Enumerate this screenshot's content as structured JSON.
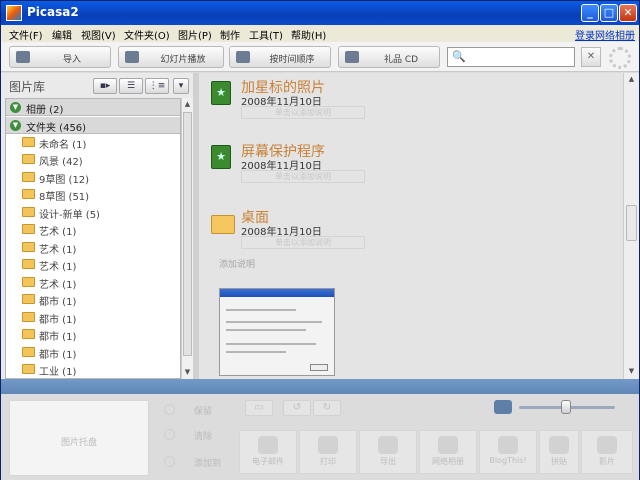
{
  "window": {
    "title": "Picasa2"
  },
  "menu": {
    "items": [
      "文件(F)",
      "编辑",
      "视图(V)",
      "文件夹(O)",
      "图片(P)",
      "制作",
      "工具(T)",
      "帮助(H)"
    ],
    "login": "登录网络相册"
  },
  "toolbar": {
    "import": "导入",
    "slideshow": "幻灯片播放",
    "timeline": "按时间顺序",
    "giftcd": "礼品 CD",
    "search_placeholder": ""
  },
  "library": {
    "title": "图片库",
    "groups": [
      {
        "label": "相册 (2)"
      },
      {
        "label": "文件夹 (456)"
      }
    ],
    "folders": [
      {
        "label": "未命名 (1)"
      },
      {
        "label": "风景 (42)"
      },
      {
        "label": "9草图 (12)"
      },
      {
        "label": "8草图 (51)"
      },
      {
        "label": "设计-新单 (5)"
      },
      {
        "label": "艺术 (1)"
      },
      {
        "label": "艺术 (1)"
      },
      {
        "label": "艺术 (1)"
      },
      {
        "label": "艺术 (1)"
      },
      {
        "label": "都市 (1)"
      },
      {
        "label": "都市 (1)"
      },
      {
        "label": "都市 (1)"
      },
      {
        "label": "都市 (1)"
      },
      {
        "label": "工业 (1)"
      }
    ]
  },
  "albums": [
    {
      "name": "加星标的照片",
      "date": "2008年11月10日",
      "desc": "单击以添加说明",
      "icon": "star-album-icon"
    },
    {
      "name": "屏幕保护程序",
      "date": "2008年11月10日",
      "desc": "单击以添加说明",
      "icon": "star-album-icon"
    },
    {
      "name": "桌面",
      "date": "2008年11月10日",
      "desc": "单击以添加说明",
      "icon": "folder-icon"
    }
  ],
  "main": {
    "add_description": "添加说明"
  },
  "bottom": {
    "tray_label": "图片托盘",
    "hold": "保留",
    "clear": "清除",
    "add_to": "添加到",
    "actions": [
      "电子邮件",
      "打印",
      "导出",
      "网络相册",
      "BlogThis!",
      "拼贴",
      "影片"
    ]
  },
  "colors": {
    "album_title": "#c98237",
    "titlebar": "#0b5ce6",
    "separator": "#6a90c0"
  }
}
